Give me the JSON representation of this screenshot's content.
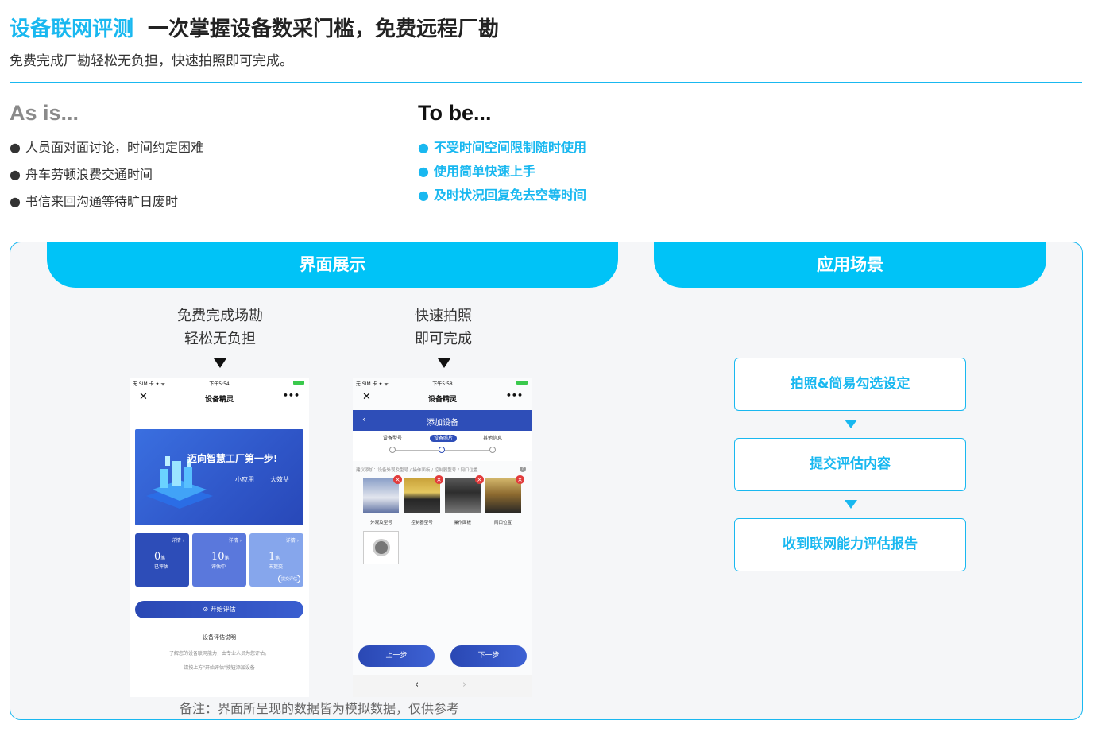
{
  "header": {
    "title_highlight": "设备联网评测",
    "title_rest": "一次掌握设备数采门槛，免费远程厂勘",
    "subtitle": "免费完成厂勘轻松无负担，快速拍照即可完成。"
  },
  "as_is": {
    "heading": "As is...",
    "bullet": "●",
    "items": [
      "人员面对面讨论，时间约定困难",
      "舟车劳顿浪费交通时间",
      "书信来回沟通等待旷日废时"
    ]
  },
  "to_be": {
    "heading": "To be...",
    "bullet": "●",
    "items": [
      "不受时间空间限制随时使用",
      "使用简单快速上手",
      "及时状况回复免去空等时间"
    ]
  },
  "panel": {
    "tab_interface": "界面展示",
    "tab_scenario": "应用场景",
    "caption_left": [
      "免费完成场勘",
      "轻松无负担"
    ],
    "caption_right": [
      "快速拍照",
      "即可完成"
    ],
    "note": "备注：界面所呈现的数据皆为模拟数据，仅供参考"
  },
  "phone1": {
    "status_left": "无 SIM 卡 ✦ ᯤ",
    "status_time": "下午5:54",
    "nav_close": "✕",
    "nav_title": "设备精灵",
    "nav_more": "•••",
    "banner_title": "迈向智慧工厂第一步!",
    "banner_tag1": "小应用",
    "banner_tag2": "大效益",
    "cards": [
      {
        "detail": "详情 ›",
        "count": "0",
        "unit": "笔",
        "status": "已评估"
      },
      {
        "detail": "详情 ›",
        "count": "10",
        "unit": "笔",
        "status": "评估中"
      },
      {
        "detail": "详情 ›",
        "count": "1",
        "unit": "笔",
        "status": "未提交",
        "pill": "提交评估"
      }
    ],
    "start_button": "⊘ 开始评估",
    "desc_title": "设备评估说明",
    "desc_line1": "了解您的设备联网能力，由专业人员为您评估。",
    "desc_line2": "请按上方\"开始评估\"按钮添加设备"
  },
  "phone2": {
    "status_left": "无 SIM 卡 ✦ ᯤ",
    "status_time": "下午5:58",
    "nav_close": "✕",
    "nav_title": "设备精灵",
    "nav_more": "•••",
    "bar_back": "‹",
    "bar_title": "添加设备",
    "steps": [
      "设备型号",
      "设备照片",
      "其他信息"
    ],
    "hint": "建议添加：设备外观及型号 / 操作面板 / 控制器型号 / 网口位置",
    "hint_icon": "?",
    "photo_remove": "×",
    "photo_labels": [
      "外观及型号",
      "控制器型号",
      "操作面板",
      "网口位置"
    ],
    "prev_button": "上一步",
    "next_button": "下一步",
    "back_arrow": "‹",
    "forward_arrow": "›"
  },
  "flow": {
    "steps": [
      "拍照&简易勾选设定",
      "提交评估内容",
      "收到联网能力评估报告"
    ]
  }
}
